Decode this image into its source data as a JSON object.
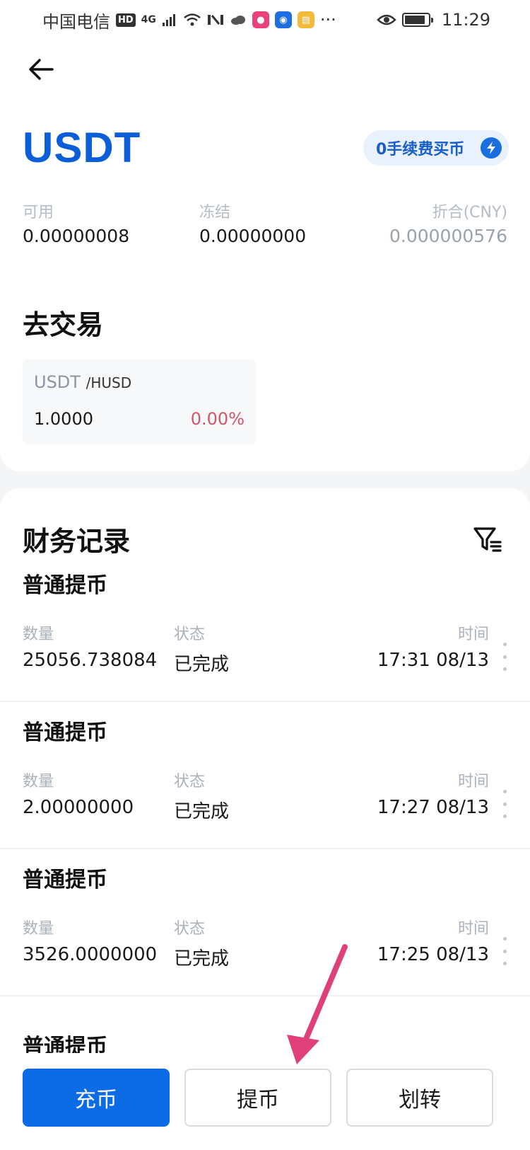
{
  "status_bar": {
    "carrier": "中国电信",
    "hd_badge": "HD",
    "network": "4G",
    "overflow": "···",
    "time": "11:29"
  },
  "asset": {
    "title": "USDT",
    "promo_label": "0手续费买币"
  },
  "balances": {
    "available_label": "可用",
    "available_value": "0.00000008",
    "frozen_label": "冻结",
    "frozen_value": "0.00000000",
    "cny_label": "折合(CNY)",
    "cny_value": "0.000000576"
  },
  "trade": {
    "title": "去交易",
    "pair_base": "USDT",
    "pair_quote": "/HUSD",
    "price": "1.0000",
    "change": "0.00%"
  },
  "records": {
    "title": "财务记录",
    "qty_label": "数量",
    "status_label": "状态",
    "time_label": "时间",
    "items": [
      {
        "type": "普通提币",
        "qty": "25056.738084",
        "status": "已完成",
        "time": "17:31 08/13"
      },
      {
        "type": "普通提币",
        "qty": "2.00000000",
        "status": "已完成",
        "time": "17:27 08/13"
      },
      {
        "type": "普通提币",
        "qty": "3526.0000000",
        "status": "已完成",
        "time": "17:25 08/13"
      }
    ],
    "partial_type": "普通提币"
  },
  "actions": {
    "deposit": "充币",
    "withdraw": "提币",
    "transfer": "划转"
  },
  "colors": {
    "brand_blue": "#0b5ed7",
    "negative_red": "#d0566a",
    "annotation_pink": "#e0407a"
  }
}
